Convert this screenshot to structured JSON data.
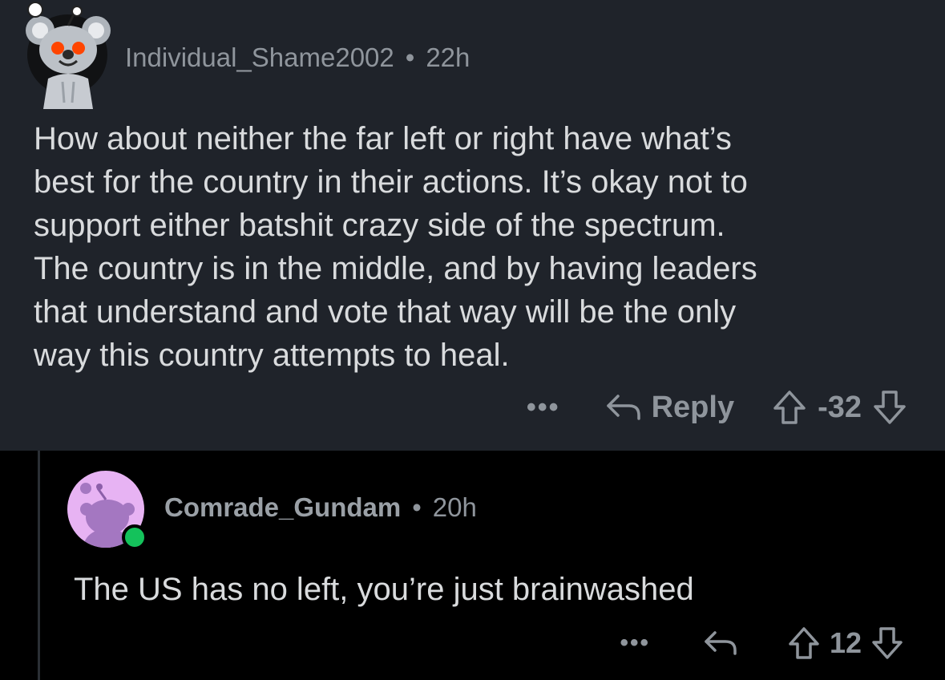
{
  "colors": {
    "parent_background": "#1f232a",
    "page_background": "#000000",
    "text": "#d9dbdd",
    "muted": "#8f959c",
    "online": "#14c25b",
    "avatar_2_background": "#e7b3f3"
  },
  "comments": [
    {
      "username": "Individual_Shame2002",
      "separator": "•",
      "age": "22h",
      "body": "How about neither the far left or right have what’s\nbest for the country in their actions. It’s okay not to\nsupport either batshit crazy side of the spectrum.\nThe country is in the middle, and by having leaders\nthat understand and vote that way will be the only\nway this country attempts to heal.",
      "more_label": "•••",
      "reply_label": "Reply",
      "score": "-32",
      "icons": [
        "more-icon",
        "reply-icon",
        "upvote-icon",
        "downvote-icon"
      ]
    },
    {
      "username": "Comrade_Gundam",
      "separator": "•",
      "age": "20h",
      "body": "The US has no left, you’re just brainwashed",
      "more_label": "•••",
      "score": "12",
      "online": true,
      "icons": [
        "more-icon",
        "reply-icon",
        "upvote-icon",
        "downvote-icon"
      ]
    }
  ]
}
